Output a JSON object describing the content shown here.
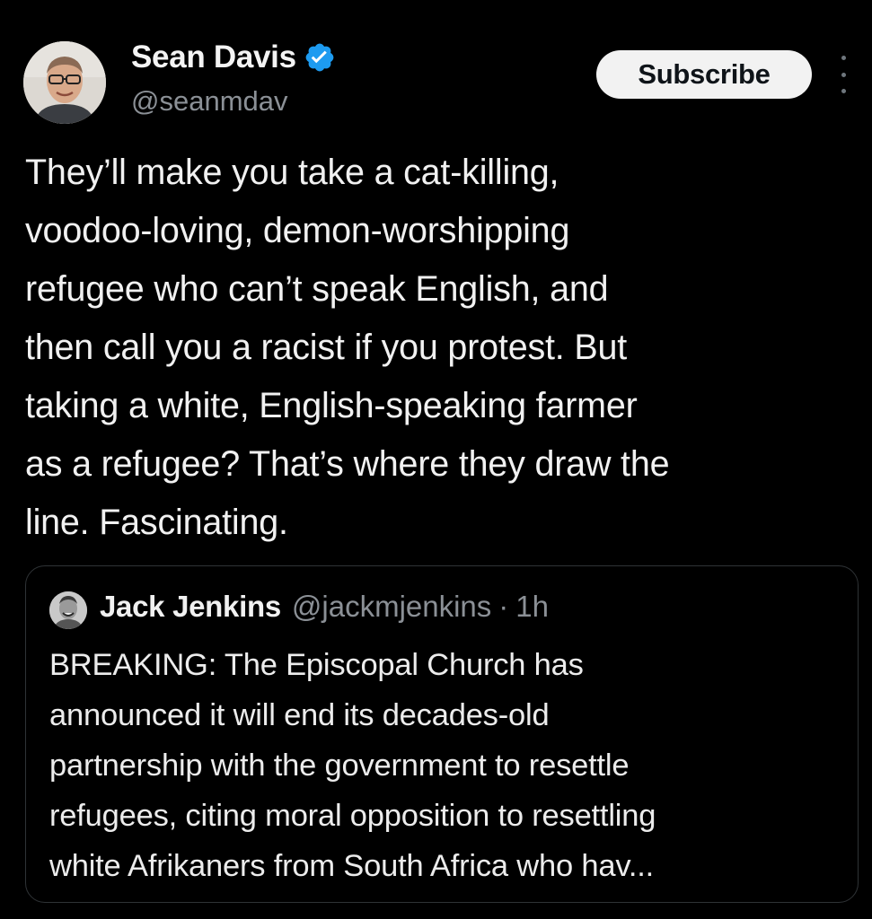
{
  "author": {
    "display_name": "Sean Davis",
    "handle": "@seanmdav",
    "verified_icon": "verified-badge-icon",
    "avatar_icon": "profile-photo"
  },
  "actions": {
    "subscribe_label": "Subscribe",
    "more_icon": "more-options-icon"
  },
  "tweet": {
    "text": "They’ll make you take a cat-killing,\nvoodoo-loving, demon-worshipping\nrefugee who can’t speak English, and\nthen call you a racist if you protest. But\ntaking a white, English-speaking farmer\nas a refugee? That’s where they draw the\nline. Fascinating."
  },
  "quoted_tweet": {
    "display_name": "Jack Jenkins",
    "handle": "@jackmjenkins",
    "separator": "·",
    "time": "1h",
    "text": "BREAKING: The Episcopal Church has\nannounced it will end its decades-old\npartnership with the government to resettle\nrefugees, citing moral opposition to resettling\nwhite Afrikaners from South Africa who hav..."
  },
  "colors": {
    "background": "#000000",
    "text_primary": "#f1f1f1",
    "text_secondary": "#8b9096",
    "verified_blue": "#1d9bf0",
    "border": "#2f3336",
    "subscribe_bg": "#f2f2f2"
  }
}
